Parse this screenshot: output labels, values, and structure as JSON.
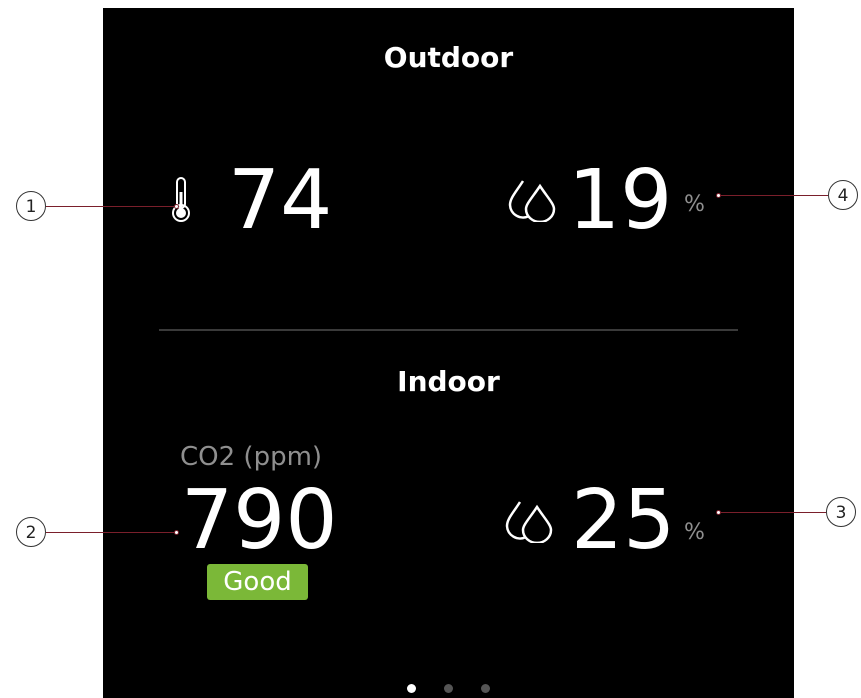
{
  "outdoor": {
    "title": "Outdoor",
    "temperature": "74",
    "humidity": "19",
    "humidity_unit": "%"
  },
  "indoor": {
    "title": "Indoor",
    "co2_label": "CO2 (ppm)",
    "co2_value": "790",
    "co2_status": "Good",
    "humidity": "25",
    "humidity_unit": "%"
  },
  "pagination": {
    "pages": 3,
    "active": 0
  },
  "callouts": [
    "1",
    "2",
    "3",
    "4"
  ],
  "icons": {
    "thermometer": "thermometer-icon",
    "humidity": "humidity-drops-icon"
  },
  "colors": {
    "background": "#000000",
    "text": "#ffffff",
    "muted": "#8f8f8f",
    "good_badge": "#7bb838",
    "callout_line": "#7a1f2b"
  }
}
